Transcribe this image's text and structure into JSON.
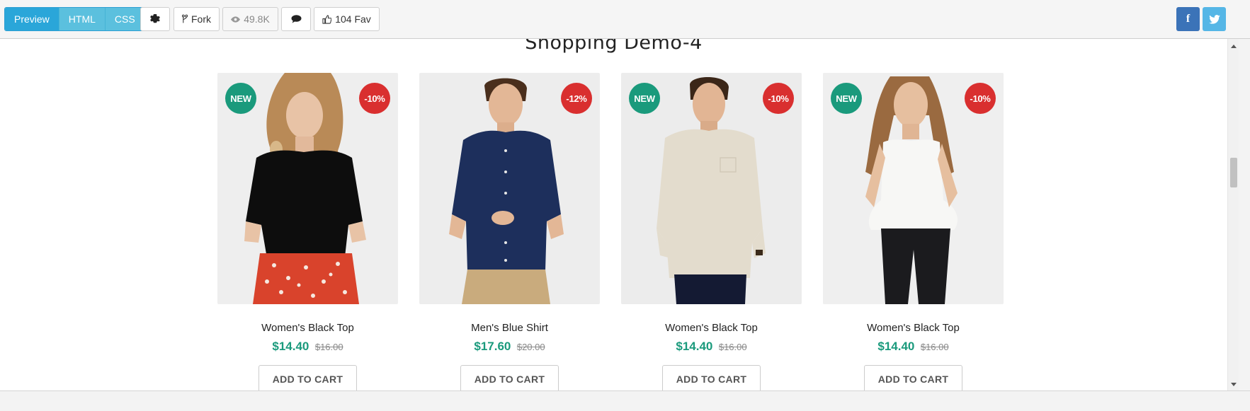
{
  "toolbar": {
    "tabs": [
      {
        "label": "Preview",
        "active": true
      },
      {
        "label": "HTML",
        "active": false
      },
      {
        "label": "CSS",
        "active": false
      }
    ],
    "settings_icon": "gear-icon",
    "fork_label": "Fork",
    "views_label": "49.8K",
    "comment_icon": "comment-icon",
    "fav_label": "104 Fav",
    "social": {
      "facebook": "f",
      "twitter": "twitter-icon"
    }
  },
  "preview": {
    "title": "Shopping Demo-4",
    "products": [
      {
        "name": "Women's Black Top",
        "price": "$14.40",
        "old_price": "$16.00",
        "badge_new": "NEW",
        "discount": "-10%",
        "cart_label": "ADD TO CART",
        "image": "woman-black-top-red-skirt"
      },
      {
        "name": "Men's Blue Shirt",
        "price": "$17.60",
        "old_price": "$20.00",
        "badge_new": "",
        "discount": "-12%",
        "cart_label": "ADD TO CART",
        "image": "man-navy-shirt-khaki-pants"
      },
      {
        "name": "Women's Black Top",
        "price": "$14.40",
        "old_price": "$16.00",
        "badge_new": "NEW",
        "discount": "-10%",
        "cart_label": "ADD TO CART",
        "image": "man-beige-linen-shirt"
      },
      {
        "name": "Women's Black Top",
        "price": "$14.40",
        "old_price": "$16.00",
        "badge_new": "NEW",
        "discount": "-10%",
        "cart_label": "ADD TO CART",
        "image": "woman-white-top-black-pants"
      }
    ]
  },
  "colors": {
    "accent": "#2aa6d9",
    "new_badge": "#1a9a7c",
    "discount_badge": "#d92f2f",
    "price": "#1a9a7c"
  }
}
